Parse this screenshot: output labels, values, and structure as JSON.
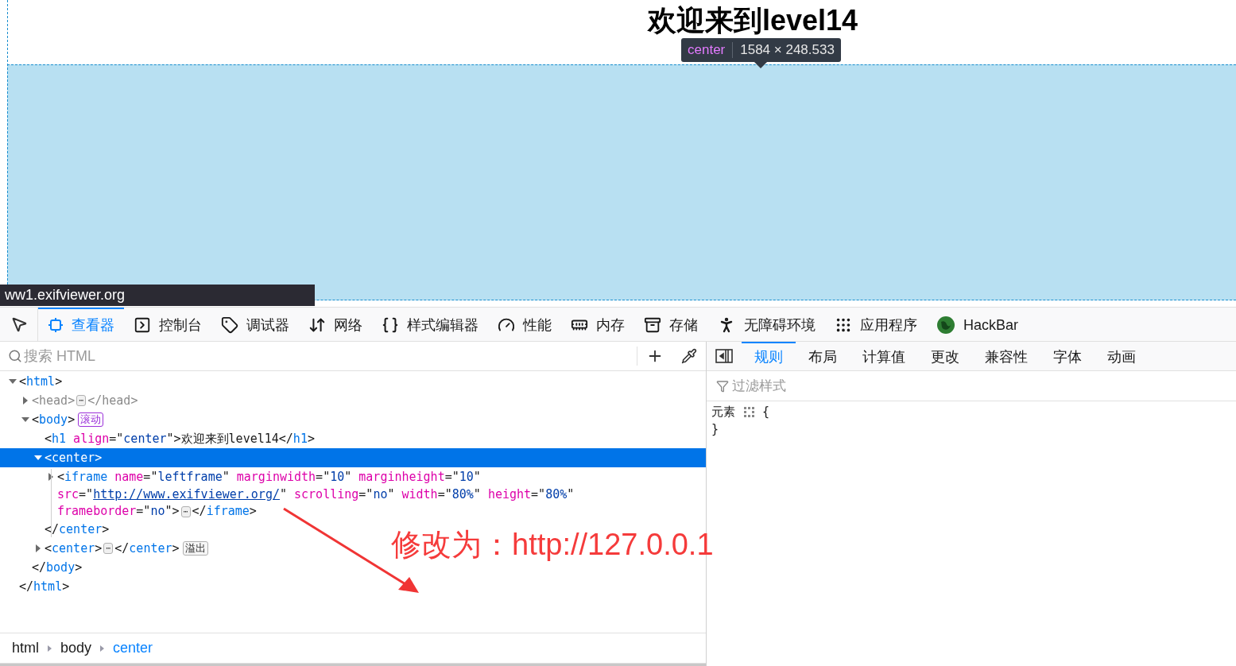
{
  "page": {
    "heading": "欢迎来到level14",
    "tooltip": {
      "tag": "center",
      "size": "1584 × 248.533"
    },
    "status_url": "ww1.exifviewer.org"
  },
  "devtools": {
    "tabs": [
      {
        "label": "查看器",
        "selected": true
      },
      {
        "label": "控制台",
        "selected": false
      },
      {
        "label": "调试器",
        "selected": false
      },
      {
        "label": "网络",
        "selected": false
      },
      {
        "label": "样式编辑器",
        "selected": false
      },
      {
        "label": "性能",
        "selected": false
      },
      {
        "label": "内存",
        "selected": false
      },
      {
        "label": "存储",
        "selected": false
      },
      {
        "label": "无障碍环境",
        "selected": false
      },
      {
        "label": "应用程序",
        "selected": false
      },
      {
        "label": "HackBar",
        "selected": false
      }
    ],
    "search": {
      "placeholder": "搜索 HTML"
    },
    "tree": [
      {
        "lines": [
          [
            {
              "kind": "punct",
              "text": "<"
            },
            {
              "kind": "tag",
              "text": "html"
            },
            {
              "kind": "punct",
              "text": ">"
            }
          ]
        ],
        "expanded": true,
        "selected": false,
        "greyed": false,
        "close": [
          {
            "kind": "punct",
            "text": "</"
          },
          {
            "kind": "tag",
            "text": "html"
          },
          {
            "kind": "punct",
            "text": ">"
          }
        ],
        "children": [
          {
            "lines": [
              [
                {
                  "kind": "punct",
                  "text": "<head>"
                },
                {
                  "kind": "more",
                  "text": "⋯"
                },
                {
                  "kind": "punct",
                  "text": "</head>"
                }
              ]
            ],
            "expanded": false,
            "selected": false,
            "greyed": true
          },
          {
            "lines": [
              [
                {
                  "kind": "punct",
                  "text": "<"
                },
                {
                  "kind": "tag",
                  "text": "body"
                },
                {
                  "kind": "punct",
                  "text": ">"
                }
              ]
            ],
            "badge": {
              "text": "滚动",
              "kind": "event"
            },
            "expanded": true,
            "selected": false,
            "greyed": false,
            "close": [
              {
                "kind": "punct",
                "text": "</"
              },
              {
                "kind": "tag",
                "text": "body"
              },
              {
                "kind": "punct",
                "text": ">"
              }
            ],
            "children": [
              {
                "lines": [
                  [
                    {
                      "kind": "punct",
                      "text": "<"
                    },
                    {
                      "kind": "tag",
                      "text": "h1"
                    },
                    {
                      "kind": "attr",
                      "text": "align"
                    },
                    {
                      "kind": "punct",
                      "text": "=\""
                    },
                    {
                      "kind": "value",
                      "text": "center"
                    },
                    {
                      "kind": "punct",
                      "text": "\">"
                    },
                    {
                      "kind": "text",
                      "text": "欢迎来到level14"
                    },
                    {
                      "kind": "punct",
                      "text": "</"
                    },
                    {
                      "kind": "tag",
                      "text": "h1"
                    },
                    {
                      "kind": "punct",
                      "text": ">"
                    }
                  ]
                ],
                "selected": false,
                "greyed": false
              },
              {
                "lines": [
                  [
                    {
                      "kind": "punct",
                      "text": "<"
                    },
                    {
                      "kind": "tag",
                      "text": "center"
                    },
                    {
                      "kind": "punct",
                      "text": ">"
                    }
                  ]
                ],
                "expanded": true,
                "selected": true,
                "greyed": false,
                "close": [
                  {
                    "kind": "punct",
                    "text": "</"
                  },
                  {
                    "kind": "tag",
                    "text": "center"
                  },
                  {
                    "kind": "punct",
                    "text": ">"
                  }
                ],
                "children": [
                  {
                    "lines": [
                      [
                        {
                          "kind": "punct",
                          "text": "<"
                        },
                        {
                          "kind": "tag",
                          "text": "iframe"
                        },
                        {
                          "kind": "attr",
                          "text": "name"
                        },
                        {
                          "kind": "punct",
                          "text": "=\""
                        },
                        {
                          "kind": "value",
                          "text": "leftframe"
                        },
                        {
                          "kind": "punct",
                          "text": "\" "
                        },
                        {
                          "kind": "attr",
                          "text": "marginwidth"
                        },
                        {
                          "kind": "punct",
                          "text": "=\""
                        },
                        {
                          "kind": "value",
                          "text": "10"
                        },
                        {
                          "kind": "punct",
                          "text": "\" "
                        },
                        {
                          "kind": "attr",
                          "text": "marginheight"
                        },
                        {
                          "kind": "punct",
                          "text": "=\""
                        },
                        {
                          "kind": "value",
                          "text": "10"
                        },
                        {
                          "kind": "punct",
                          "text": "\""
                        }
                      ],
                      [
                        {
                          "kind": "attr",
                          "text": "src"
                        },
                        {
                          "kind": "punct",
                          "text": "=\""
                        },
                        {
                          "kind": "link",
                          "text": "http://www.exifviewer.org/"
                        },
                        {
                          "kind": "punct",
                          "text": "\" "
                        },
                        {
                          "kind": "attr",
                          "text": "scrolling"
                        },
                        {
                          "kind": "punct",
                          "text": "=\""
                        },
                        {
                          "kind": "value",
                          "text": "no"
                        },
                        {
                          "kind": "punct",
                          "text": "\" "
                        },
                        {
                          "kind": "attr",
                          "text": "width"
                        },
                        {
                          "kind": "punct",
                          "text": "=\""
                        },
                        {
                          "kind": "value",
                          "text": "80%"
                        },
                        {
                          "kind": "punct",
                          "text": "\" "
                        },
                        {
                          "kind": "attr",
                          "text": "height"
                        },
                        {
                          "kind": "punct",
                          "text": "=\""
                        },
                        {
                          "kind": "value",
                          "text": "80%"
                        },
                        {
                          "kind": "punct",
                          "text": "\""
                        }
                      ],
                      [
                        {
                          "kind": "attr",
                          "text": "frameborder"
                        },
                        {
                          "kind": "punct",
                          "text": "=\""
                        },
                        {
                          "kind": "value",
                          "text": "no"
                        },
                        {
                          "kind": "punct",
                          "text": "\">"
                        },
                        {
                          "kind": "more",
                          "text": "⋯"
                        },
                        {
                          "kind": "punct",
                          "text": "</"
                        },
                        {
                          "kind": "tag",
                          "text": "iframe"
                        },
                        {
                          "kind": "punct",
                          "text": ">"
                        }
                      ]
                    ],
                    "expanded": false,
                    "selected": false,
                    "greyed": false
                  }
                ]
              },
              {
                "lines": [
                  [
                    {
                      "kind": "punct",
                      "text": "<"
                    },
                    {
                      "kind": "tag",
                      "text": "center"
                    },
                    {
                      "kind": "punct",
                      "text": ">"
                    },
                    {
                      "kind": "more",
                      "text": "⋯"
                    },
                    {
                      "kind": "punct",
                      "text": "</"
                    },
                    {
                      "kind": "tag",
                      "text": "center"
                    },
                    {
                      "kind": "punct",
                      "text": ">"
                    }
                  ]
                ],
                "badge": {
                  "text": "溢出",
                  "kind": "plain"
                },
                "expanded": false,
                "selected": false,
                "greyed": false
              }
            ]
          }
        ]
      }
    ],
    "breadcrumbs": [
      {
        "label": "html",
        "selected": false
      },
      {
        "label": "body",
        "selected": false
      },
      {
        "label": "center",
        "selected": true
      }
    ],
    "side_tabs": [
      {
        "label": "规则",
        "selected": true
      },
      {
        "label": "布局",
        "selected": false
      },
      {
        "label": "计算值",
        "selected": false
      },
      {
        "label": "更改",
        "selected": false
      },
      {
        "label": "兼容性",
        "selected": false
      },
      {
        "label": "字体",
        "selected": false
      },
      {
        "label": "动画",
        "selected": false
      }
    ],
    "filter": {
      "placeholder": "过滤样式"
    },
    "rule": {
      "selector": "元素",
      "open": "{",
      "close": "}"
    }
  },
  "annotation": {
    "text": "修改为：http://127.0.0.1"
  }
}
